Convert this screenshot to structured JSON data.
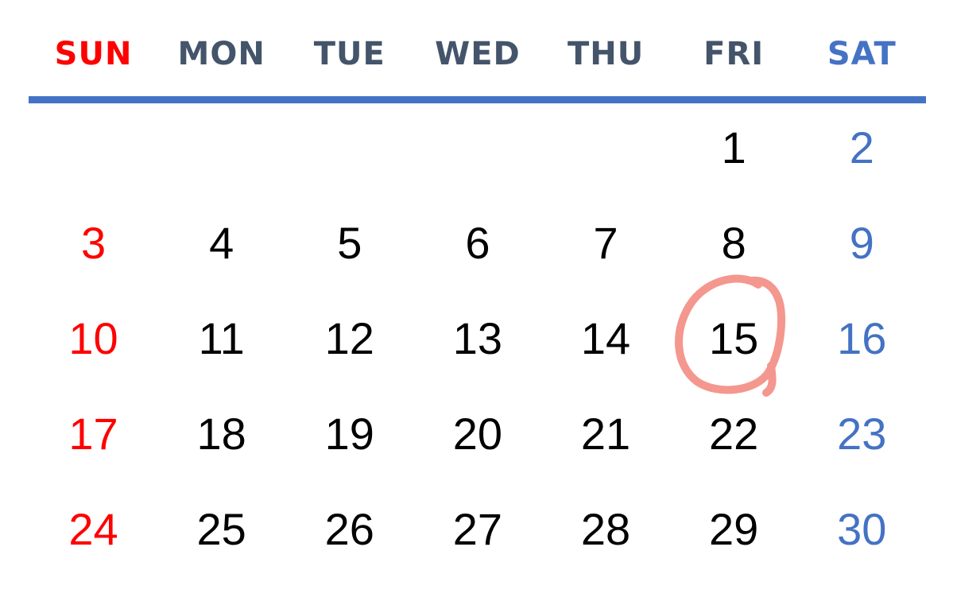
{
  "colors": {
    "sunday": "#ff0000",
    "saturday": "#4472c4",
    "weekday_header": "#44546a",
    "date_text": "#000000",
    "rule": "#4472c4",
    "highlight_circle": "#f4978e"
  },
  "header": {
    "days": [
      "SUN",
      "MON",
      "TUE",
      "WED",
      "THU",
      "FRI",
      "SAT"
    ]
  },
  "weeks": [
    [
      "",
      "",
      "",
      "",
      "",
      "1",
      "2"
    ],
    [
      "3",
      "4",
      "5",
      "6",
      "7",
      "8",
      "9"
    ],
    [
      "10",
      "11",
      "12",
      "13",
      "14",
      "15",
      "16"
    ],
    [
      "17",
      "18",
      "19",
      "20",
      "21",
      "22",
      "23"
    ],
    [
      "24",
      "25",
      "26",
      "27",
      "28",
      "29",
      "30"
    ]
  ],
  "highlighted_date": "15",
  "highlight_icon": "hand-drawn-circle-icon"
}
